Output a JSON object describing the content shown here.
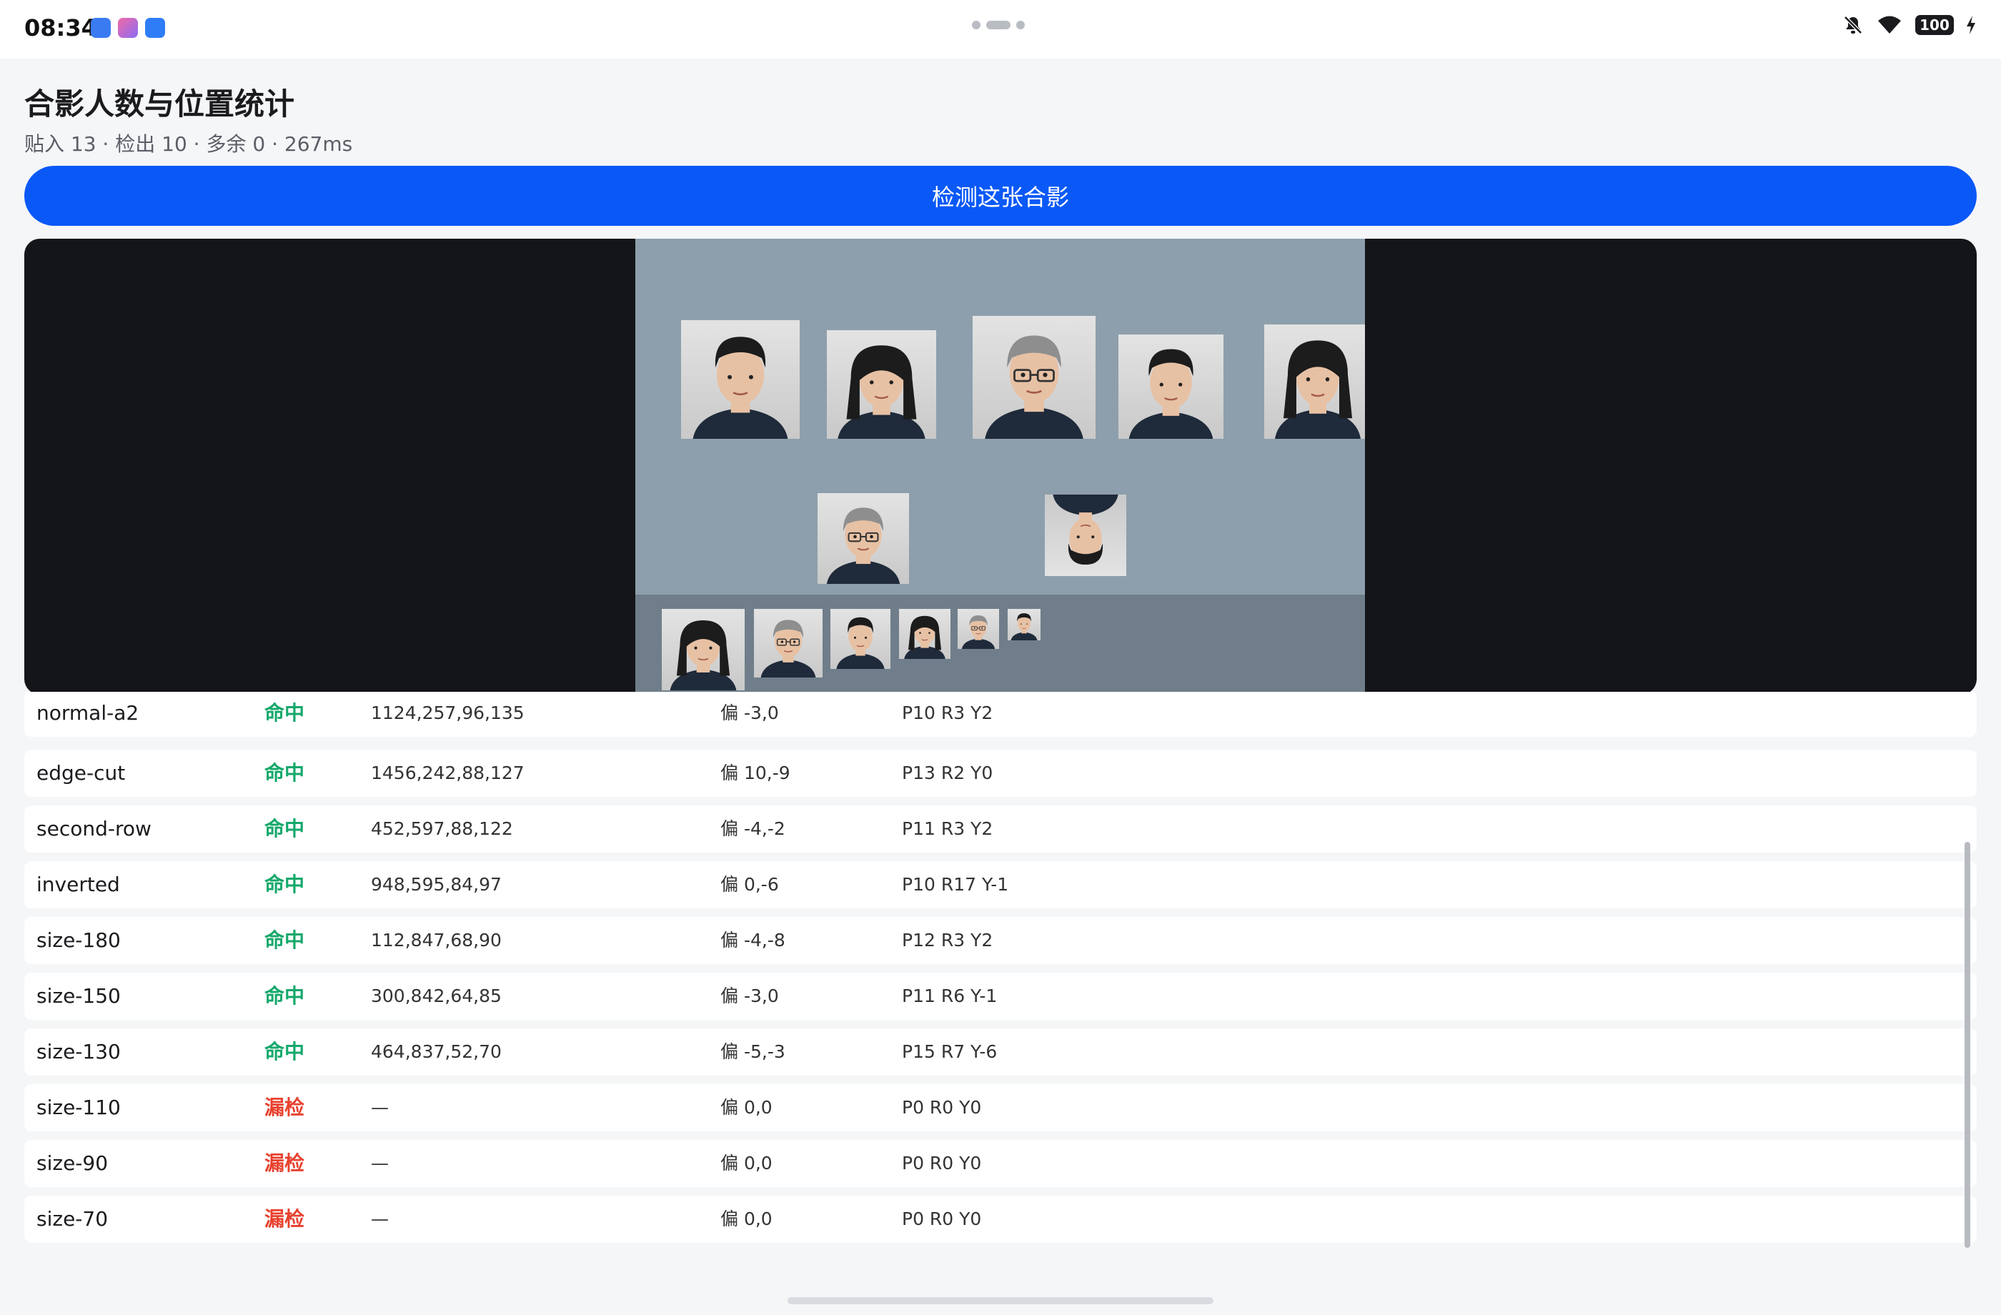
{
  "status_bar": {
    "time": "08:34",
    "app_icons": [
      {
        "name": "usb-app-icon",
        "color": "#3a7bf2"
      },
      {
        "name": "gallery-app-icon",
        "color": "#f06aa5"
      },
      {
        "name": "assistant-app-icon",
        "color": "#2f7df6"
      }
    ],
    "battery": "100",
    "indicators": [
      "mute-icon",
      "wifi-icon",
      "battery-icon",
      "charging-icon"
    ]
  },
  "header": {
    "title": "合影人数与位置统计",
    "subtitle": "贴入 13 · 检出 10 · 多余 0 · 267ms"
  },
  "detect_button": {
    "label": "检测这张合影"
  },
  "preview": {
    "background": "#141518",
    "photo_background": "#8d9fac",
    "faces": [
      {
        "id": "face-man-1",
        "kind": "young-man",
        "inverted": false
      },
      {
        "id": "face-woman-1",
        "kind": "woman",
        "inverted": false
      },
      {
        "id": "face-senior-1",
        "kind": "senior-man-glasses",
        "inverted": false
      },
      {
        "id": "face-man-2",
        "kind": "young-man",
        "inverted": false
      },
      {
        "id": "face-woman-2",
        "kind": "woman",
        "inverted": false
      },
      {
        "id": "face-senior-2",
        "kind": "senior-man-glasses",
        "inverted": false
      },
      {
        "id": "face-inverted",
        "kind": "young-man",
        "inverted": true
      },
      {
        "id": "face-size-180",
        "kind": "woman",
        "inverted": false
      },
      {
        "id": "face-size-150",
        "kind": "senior-man-glasses",
        "inverted": false
      },
      {
        "id": "face-size-130",
        "kind": "young-man",
        "inverted": false
      },
      {
        "id": "face-size-110",
        "kind": "woman",
        "inverted": false
      },
      {
        "id": "face-size-90",
        "kind": "senior-man-glasses",
        "inverted": false
      },
      {
        "id": "face-size-70",
        "kind": "young-man",
        "inverted": false
      }
    ]
  },
  "results": {
    "status_colors": {
      "命中": "#14a86a",
      "漏检": "#e8412f"
    },
    "rows": [
      {
        "name": "normal-a2",
        "status": "命中",
        "box": "1124,257,96,135",
        "offset": "偏 -3,0",
        "pose": "P10 R3 Y2"
      },
      {
        "name": "edge-cut",
        "status": "命中",
        "box": "1456,242,88,127",
        "offset": "偏 10,-9",
        "pose": "P13 R2 Y0"
      },
      {
        "name": "second-row",
        "status": "命中",
        "box": "452,597,88,122",
        "offset": "偏 -4,-2",
        "pose": "P11 R3 Y2"
      },
      {
        "name": "inverted",
        "status": "命中",
        "box": "948,595,84,97",
        "offset": "偏 0,-6",
        "pose": "P10 R17 Y-1"
      },
      {
        "name": "size-180",
        "status": "命中",
        "box": "112,847,68,90",
        "offset": "偏 -4,-8",
        "pose": "P12 R3 Y2"
      },
      {
        "name": "size-150",
        "status": "命中",
        "box": "300,842,64,85",
        "offset": "偏 -3,0",
        "pose": "P11 R6 Y-1"
      },
      {
        "name": "size-130",
        "status": "命中",
        "box": "464,837,52,70",
        "offset": "偏 -5,-3",
        "pose": "P15 R7 Y-6"
      },
      {
        "name": "size-110",
        "status": "漏检",
        "box": "—",
        "offset": "偏 0,0",
        "pose": "P0 R0 Y0"
      },
      {
        "name": "size-90",
        "status": "漏检",
        "box": "—",
        "offset": "偏 0,0",
        "pose": "P0 R0 Y0"
      },
      {
        "name": "size-70",
        "status": "漏检",
        "box": "—",
        "offset": "偏 0,0",
        "pose": "P0 R0 Y0"
      }
    ]
  }
}
